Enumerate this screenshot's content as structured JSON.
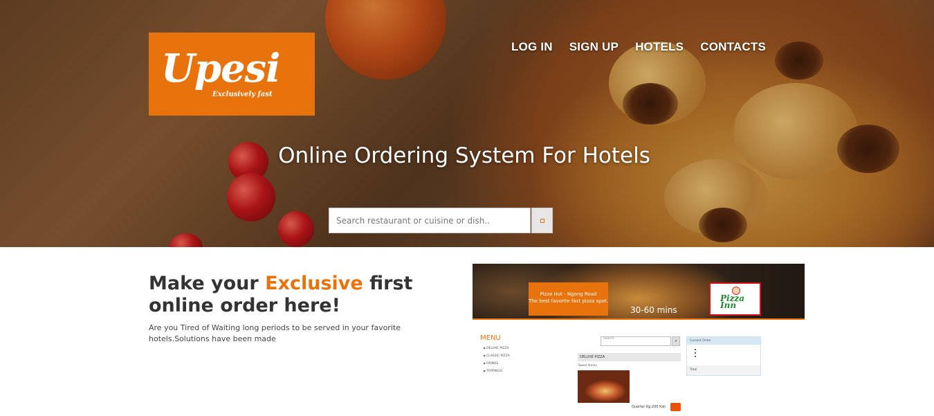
{
  "brand": {
    "name": "Upesi",
    "tagline": "Exclusively fast",
    "accent_color": "#e8720c"
  },
  "nav": {
    "items": [
      {
        "label": "LOG IN"
      },
      {
        "label": "SIGN UP"
      },
      {
        "label": "HOTELS"
      },
      {
        "label": "CONTACTS"
      }
    ]
  },
  "hero": {
    "title": "Online Ordering System For Hotels",
    "search_placeholder": "Search restaurant or cuisine or dish..",
    "search_button_icon": "search-icon"
  },
  "intro": {
    "headline_before": "Make your ",
    "headline_accent": "Exclusive",
    "headline_after": " first online order here!",
    "body": "Are you Tired of Waiting long periods to be served in your favorite hotels.Solutions have been made"
  },
  "preview": {
    "banner_line1": "Pizza Hut - Ngong Road",
    "banner_line2": "The best favorite fast pizza spot.",
    "delivery_time": "30-60 mins",
    "restaurant_logo": "Pizza Inn",
    "menu_title": "MENU",
    "menu_items": [
      "DELUXE PIZZA",
      "CLASSIC PIZZA",
      "DRINKS",
      "TOPPINGS"
    ],
    "search_placeholder": "Search",
    "section_title": "DELUXE PIZZA",
    "item_name": "Sweet Aroma",
    "item_price": "Quarter Kg:200 Ksh",
    "order_title": "Current Order",
    "order_total_label": "Total"
  }
}
